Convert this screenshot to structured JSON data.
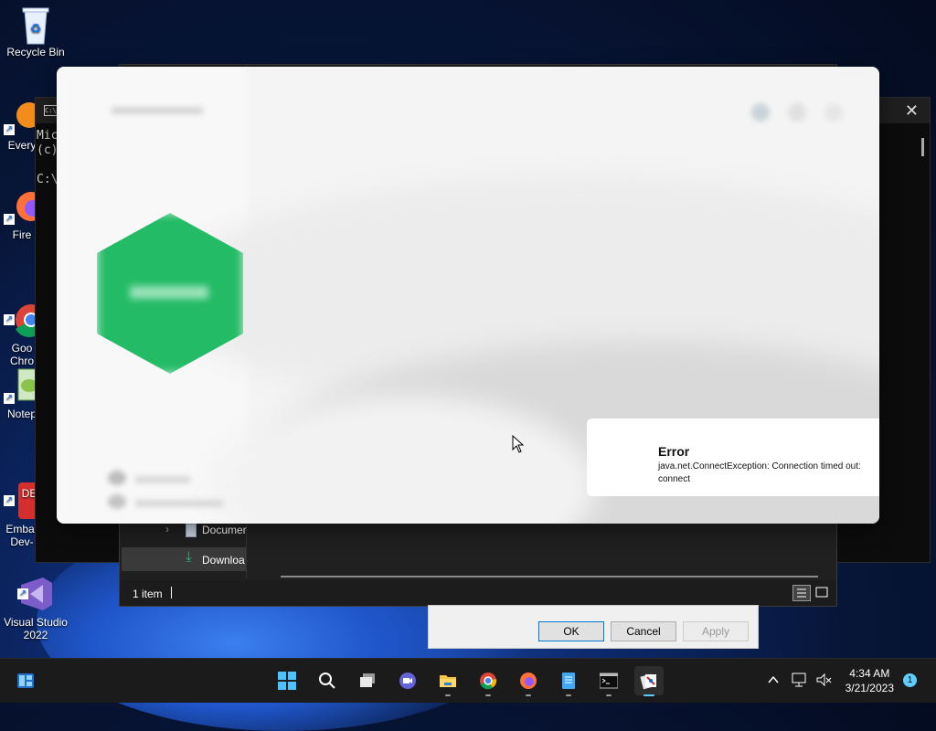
{
  "desktop": {
    "icons": [
      {
        "label": "Recycle Bin"
      },
      {
        "label": "Every"
      },
      {
        "label": "Fire"
      },
      {
        "label": "Goo\nChro"
      },
      {
        "label": "Notep"
      },
      {
        "label": "Embar\nDev-"
      },
      {
        "label": "Visual Studio\n2022"
      }
    ]
  },
  "console": {
    "close_glyph": "✕",
    "lines": [
      "Mic",
      "(c)",
      "",
      "C:\\U"
    ]
  },
  "explorer": {
    "nav_items": [
      {
        "label": "Documer",
        "icon": "document-icon"
      },
      {
        "label": "Downloa",
        "icon": "download-icon"
      }
    ],
    "status_text": "1 item",
    "view_details": "details-view-icon",
    "view_tiles": "tiles-view-icon"
  },
  "properties_dialog": {
    "ok_label": "OK",
    "cancel_label": "Cancel",
    "apply_label": "Apply"
  },
  "notification": {
    "title": "Error",
    "message": "java.net.ConnectException: Connection timed out: connect"
  },
  "taskbar": {
    "apps": [
      "start",
      "search",
      "task-view",
      "teams-chat",
      "file-explorer",
      "chrome",
      "firefox",
      "notepad",
      "terminal",
      "active-app"
    ],
    "time": "4:34 AM",
    "date": "3/21/2023",
    "notification_count": "1"
  },
  "colors": {
    "accent": "#60cdff",
    "hex_green": "#23bb66",
    "taskbar_bg": "#1b1b1b"
  }
}
